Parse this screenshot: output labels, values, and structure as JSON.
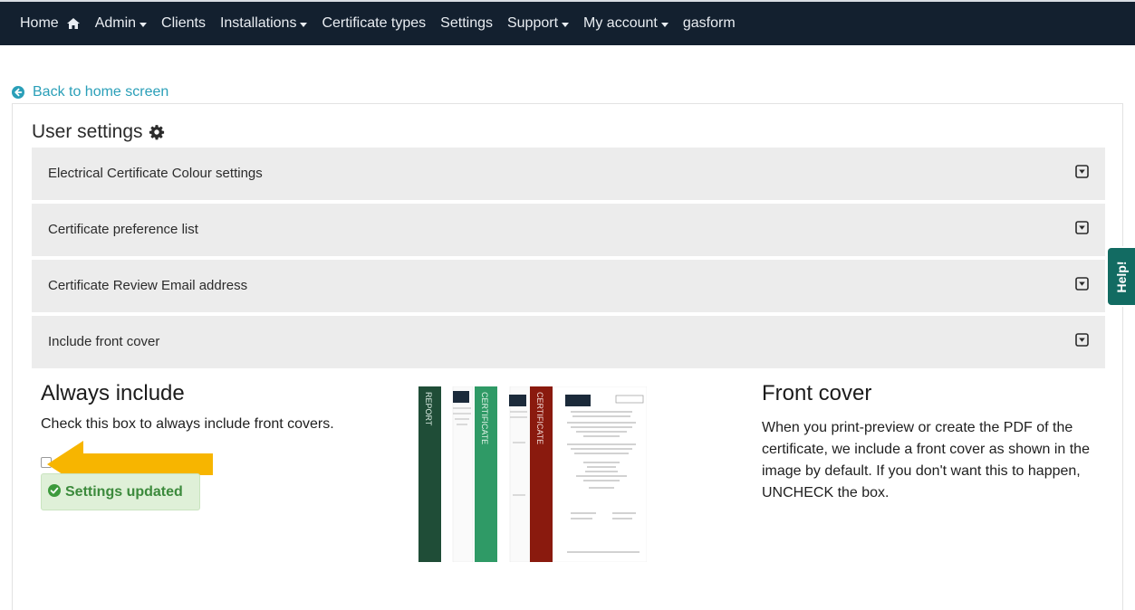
{
  "nav": {
    "items": [
      {
        "label": "Home",
        "icon": "home-icon"
      },
      {
        "label": "Admin",
        "dropdown": true
      },
      {
        "label": "Clients"
      },
      {
        "label": "Installations",
        "dropdown": true
      },
      {
        "label": "Certificate types"
      },
      {
        "label": "Settings"
      },
      {
        "label": "Support",
        "dropdown": true
      },
      {
        "label": "My account",
        "dropdown": true
      },
      {
        "label": "gasform"
      }
    ]
  },
  "back_link": {
    "label": "Back to home screen",
    "icon": "circle-arrow-left-icon"
  },
  "page": {
    "title": "User settings",
    "title_icon": "gear-icon"
  },
  "accordion": [
    {
      "label": "Electrical Certificate Colour settings"
    },
    {
      "label": "Certificate preference list"
    },
    {
      "label": "Certificate Review Email address"
    },
    {
      "label": "Include front cover"
    }
  ],
  "front_cover_section": {
    "left_heading": "Always include",
    "left_text": "Check this box to always include front covers.",
    "checkbox_checked": false,
    "status_message": "Settings updated",
    "right_heading": "Front cover",
    "right_text": "When you print-preview or create the PDF of the certificate, we include a front cover as shown in the image by default. If you don't want this to happen, UNCHECK the box.",
    "preview_covers": [
      {
        "spine_text": "REPORT",
        "color": "#1f4d37"
      },
      {
        "spine_text": "CERTIFICATE",
        "color": "#2f9a66"
      },
      {
        "spine_text": "CERTIFICATE",
        "color": "#8a1a0e"
      }
    ]
  },
  "help_tab": {
    "label": "Help!"
  },
  "colors": {
    "navbar": "#13202f",
    "link": "#2a9fb8",
    "accent_arrow": "#f7b500",
    "success_bg": "#dff0d8",
    "success_text": "#3c8a3c",
    "help_tab": "#126b62"
  }
}
